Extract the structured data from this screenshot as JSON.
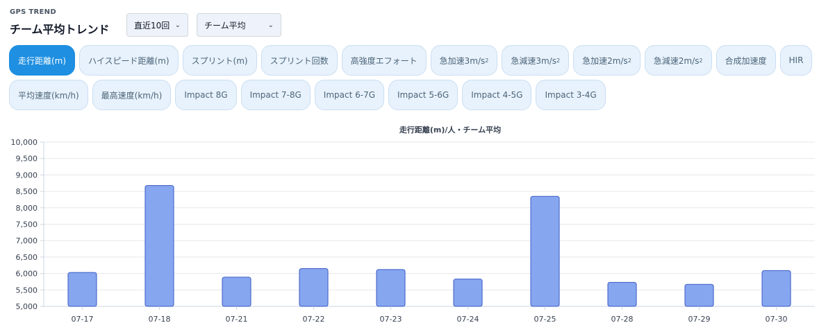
{
  "header": {
    "eyebrow": "GPS TREND",
    "title": "チーム平均トレンド"
  },
  "controls": {
    "period": "直近10回",
    "mode": "チーム平均"
  },
  "metric_tabs": [
    [
      {
        "label": "走行距離(m)",
        "active": true
      },
      {
        "label": "ハイスピード距離(m)"
      },
      {
        "label": "スプリント(m)"
      },
      {
        "label": "スプリント回数"
      },
      {
        "label": "高強度エフォート"
      },
      {
        "label": "急加速3m/s",
        "sup": "2"
      },
      {
        "label": "急減速3m/s",
        "sup": "2"
      },
      {
        "label": "急加速2m/s",
        "sup": "2"
      },
      {
        "label": "急減速2m/s",
        "sup": "2"
      },
      {
        "label": "合成加速度"
      },
      {
        "label": "HIR"
      }
    ],
    [
      {
        "label": "平均速度(km/h)"
      },
      {
        "label": "最高速度(km/h)"
      },
      {
        "label": "Impact 8G"
      },
      {
        "label": "Impact 7-8G"
      },
      {
        "label": "Impact 6-7G"
      },
      {
        "label": "Impact 5-6G"
      },
      {
        "label": "Impact 4-5G"
      },
      {
        "label": "Impact 3-4G"
      }
    ]
  ],
  "colors": {
    "bar_fill": "#86a6f0",
    "bar_stroke": "#3b5bc4",
    "active_tab": "#1e8fe1"
  },
  "chart_data": {
    "type": "bar",
    "title": "走行距離(m)/人・チーム平均",
    "categories": [
      "07-17",
      "07-18",
      "07-21",
      "07-22",
      "07-23",
      "07-24",
      "07-25",
      "07-28",
      "07-29",
      "07-30"
    ],
    "values": [
      6030,
      8680,
      5890,
      6150,
      6120,
      5830,
      8350,
      5730,
      5670,
      6090
    ],
    "ylim": [
      5000,
      10000
    ],
    "yticks": [
      "5,000",
      "5,500",
      "6,000",
      "6,500",
      "7,000",
      "7,500",
      "8,000",
      "8,500",
      "9,000",
      "9,500",
      "10,000"
    ],
    "grid": true,
    "legend": "none"
  }
}
